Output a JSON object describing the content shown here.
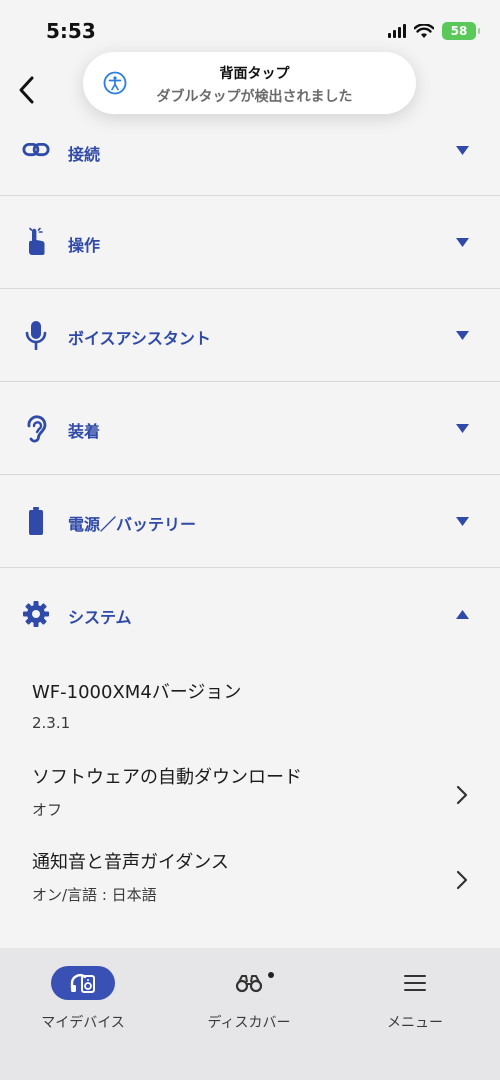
{
  "status": {
    "time": "5:53",
    "battery": "58"
  },
  "toast": {
    "title": "背面タップ",
    "subtitle": "ダブルタップが検出されました",
    "icon": "accessibility-icon"
  },
  "sections": [
    {
      "label": "接続",
      "icon": "link-icon"
    },
    {
      "label": "操作",
      "icon": "touch-icon"
    },
    {
      "label": "ボイスアシスタント",
      "icon": "microphone-icon"
    },
    {
      "label": "装着",
      "icon": "ear-icon"
    },
    {
      "label": "電源／バッテリー",
      "icon": "battery-icon"
    }
  ],
  "system": {
    "label": "システム",
    "icon": "gear-icon",
    "items": [
      {
        "title": "WF-1000XM4バージョン",
        "value": "2.3.1"
      },
      {
        "title": "ソフトウェアの自動ダウンロード",
        "value": "オフ"
      },
      {
        "title": "通知音と音声ガイダンス",
        "value": "オン/言語 : 日本語"
      }
    ]
  },
  "tabs": [
    {
      "label": "マイデバイス",
      "icon": "device-icon",
      "active": true
    },
    {
      "label": "ディスカバー",
      "icon": "binoculars-icon",
      "active": false
    },
    {
      "label": "メニュー",
      "icon": "menu-icon",
      "active": false
    }
  ],
  "colors": {
    "accent": "#2f4aa8",
    "tab_active": "#3950b5",
    "background": "#f4f4f4"
  }
}
